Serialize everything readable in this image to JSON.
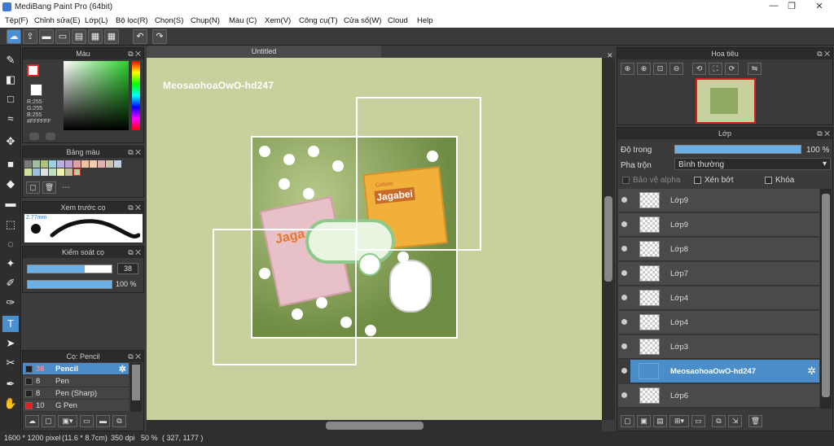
{
  "window": {
    "title": "MediBang Paint Pro (64bit)"
  },
  "menu": [
    "Tệp(F)",
    "Chỉnh sửa(E)",
    "Lớp(L)",
    "Bộ lọc(R)",
    "Chọn(S)",
    "Chụp(N)",
    "Màu (C)",
    "Xem(V)",
    "Công cụ(T)",
    "Cửa sổ(W)",
    "Cloud",
    "Help"
  ],
  "canvas": {
    "tab": "Untitled",
    "watermark": "MeosaohoaOwO-hd247"
  },
  "color_panel": {
    "title": "Màu",
    "r": "R:255",
    "g": "G:255",
    "b": "B:255",
    "hex": "#FFFFFF"
  },
  "palette_panel": {
    "title": "Bảng màu",
    "dash": "---"
  },
  "brush_preview": {
    "title": "Xem trước cọ",
    "size": "2.77mm"
  },
  "brush_control": {
    "title": "Kiểm soát cọ",
    "size_value": "38",
    "opacity_value": "100 %",
    "size_fill": 0.68,
    "opacity_fill": 1.0
  },
  "brush_list": {
    "title": "Cọ: Pencil",
    "items": [
      {
        "size": "38",
        "name": "Pencil",
        "color": "#222222"
      },
      {
        "size": "8",
        "name": "Pen",
        "color": "#222222"
      },
      {
        "size": "8",
        "name": "Pen (Sharp)",
        "color": "#222222"
      },
      {
        "size": "10",
        "name": "G Pen",
        "color": "#e02020"
      }
    ]
  },
  "navigator": {
    "title": "Hoa tiêu"
  },
  "layers": {
    "title": "Lớp",
    "opacity_label": "Độ trong",
    "opacity_value": "100 %",
    "blend_label": "Pha trộn",
    "blend_value": "Bình thường",
    "protect_alpha": "Bảo vệ alpha",
    "clipping": "Xén bớt",
    "lock": "Khóa",
    "items": [
      "Lớp9",
      "Lớp9",
      "Lớp8",
      "Lớp7",
      "Lớp4",
      "Lớp4",
      "Lớp3",
      "MeosaohoaOwO-hd247",
      "Lớp6"
    ]
  },
  "status": {
    "size": "1600 * 1200 pixel",
    "cm": "(11.6 * 8.7cm)",
    "dpi": "350 dpi",
    "zoom": "50 %",
    "coords": "( 327, 1177 )"
  },
  "art": {
    "label_left": "Jaga",
    "label_right": "Jagabei",
    "brand": "Calbee"
  }
}
